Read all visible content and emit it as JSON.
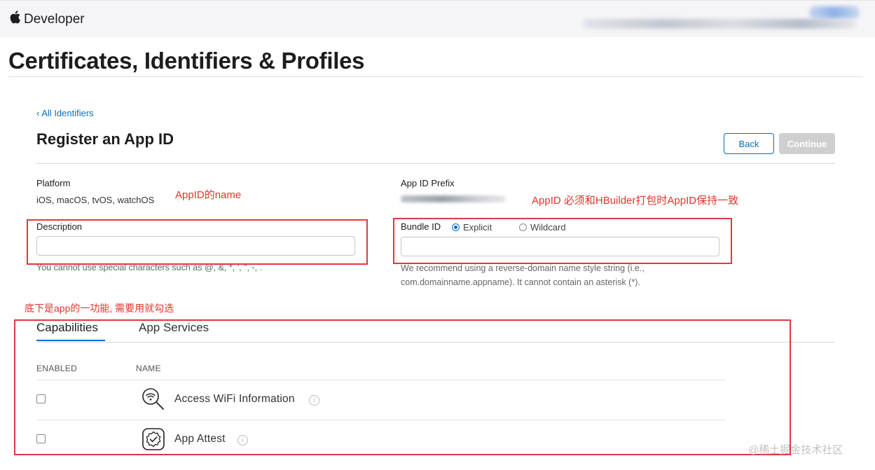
{
  "header": {
    "brand": "Developer",
    "page_title": "Certificates, Identifiers & Profiles"
  },
  "form": {
    "breadcrumb": "‹ All Identifiers",
    "title": "Register an App ID",
    "back_label": "Back",
    "continue_label": "Continue",
    "platform_label": "Platform",
    "platform_value": "iOS, macOS, tvOS, watchOS",
    "prefix_label": "App ID Prefix",
    "description_label": "Description",
    "description_value": "",
    "description_help": "You cannot use special characters such as @, &, *, ', \", -, .",
    "bundle_label": "Bundle ID",
    "bundle_value": "",
    "radio_explicit": "Explicit",
    "radio_wildcard": "Wildcard",
    "bundle_help_1": "We recommend using a reverse-domain name style string (i.e.,",
    "bundle_help_2": "com.domainname.appname). It cannot contain an asterisk (*)."
  },
  "tabs": [
    {
      "label": "Capabilities",
      "active": true
    },
    {
      "label": "App Services",
      "active": false
    }
  ],
  "table": {
    "headers": {
      "enabled": "ENABLED",
      "name": "NAME"
    },
    "rows": [
      {
        "name": "Access WiFi Information",
        "enabled": false,
        "icon": "wifi-search-icon"
      },
      {
        "name": "App Attest",
        "enabled": false,
        "icon": "badge-check-icon"
      }
    ]
  },
  "annotations": {
    "name_note": "AppID的name",
    "bundle_note": "AppID 必须和HBuilder打包时AppID保持一致",
    "capabilities_note": "底下是app的一功能, 需要用就勾选"
  },
  "watermark": "@稀土掘金技术社区",
  "colors": {
    "link_blue": "#0070c9",
    "annotation_red": "#e0362b",
    "disabled_button": "#cfcfcf"
  }
}
